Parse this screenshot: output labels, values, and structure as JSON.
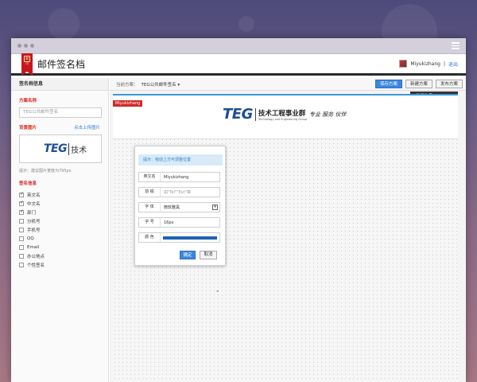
{
  "app": {
    "title": "邮件签名档",
    "logo_stamp": "腾讯"
  },
  "user": {
    "name": "Miyukizhang",
    "separator": "|",
    "logout": "退出"
  },
  "sidebar": {
    "header": "签名档信息",
    "scheme_label": "方案名称",
    "scheme_value": "TEG公共邮件签名",
    "bg_label": "背景图片",
    "bg_upload": "点击上传图片",
    "bg_preview_logo": "TEG",
    "bg_preview_cn": "技术",
    "bg_hint": "提示：建议图片宽度为795px",
    "sig_info_label": "签名信息",
    "items": [
      {
        "label": "英文名",
        "checked": true
      },
      {
        "label": "中文名",
        "checked": true
      },
      {
        "label": "部门",
        "checked": true
      },
      {
        "label": "分机号",
        "checked": false
      },
      {
        "label": "手机号",
        "checked": false
      },
      {
        "label": "QQ",
        "checked": false
      },
      {
        "label": "Email",
        "checked": false
      },
      {
        "label": "办公地点",
        "checked": false
      },
      {
        "label": "个性签名",
        "checked": false
      }
    ]
  },
  "toolbar": {
    "current_label": "当前方案：",
    "current_value": "TEG公共邮件签名",
    "save_label": "保存方案",
    "new_label": "新建方案",
    "publish_label": "发布方案"
  },
  "coord_tip": "坐标信息：(36,30)",
  "signature": {
    "tag": "Miyukizhang",
    "logo": "TEG",
    "logo_cn": "技术工程事业群",
    "logo_en": "Technology and Engineering Group",
    "slogan": "专业 服务 伙伴"
  },
  "popup": {
    "tip": "提示：拖动上方可调整位置",
    "rows": [
      {
        "label": "英文名",
        "value": "Miyukizhang"
      },
      {
        "label": "前  缀",
        "value": "如\"Tel\"\"Ext\"等"
      },
      {
        "label": "字  体",
        "value": "微软雅黑"
      },
      {
        "label": "字  号",
        "value": "16px"
      },
      {
        "label": "颜  色",
        "value": ""
      }
    ],
    "confirm": "确定",
    "cancel": "取消"
  },
  "colors": {
    "accent": "#3a87e0",
    "brand_red": "#c8161d",
    "swatch": "#1d62b5"
  }
}
